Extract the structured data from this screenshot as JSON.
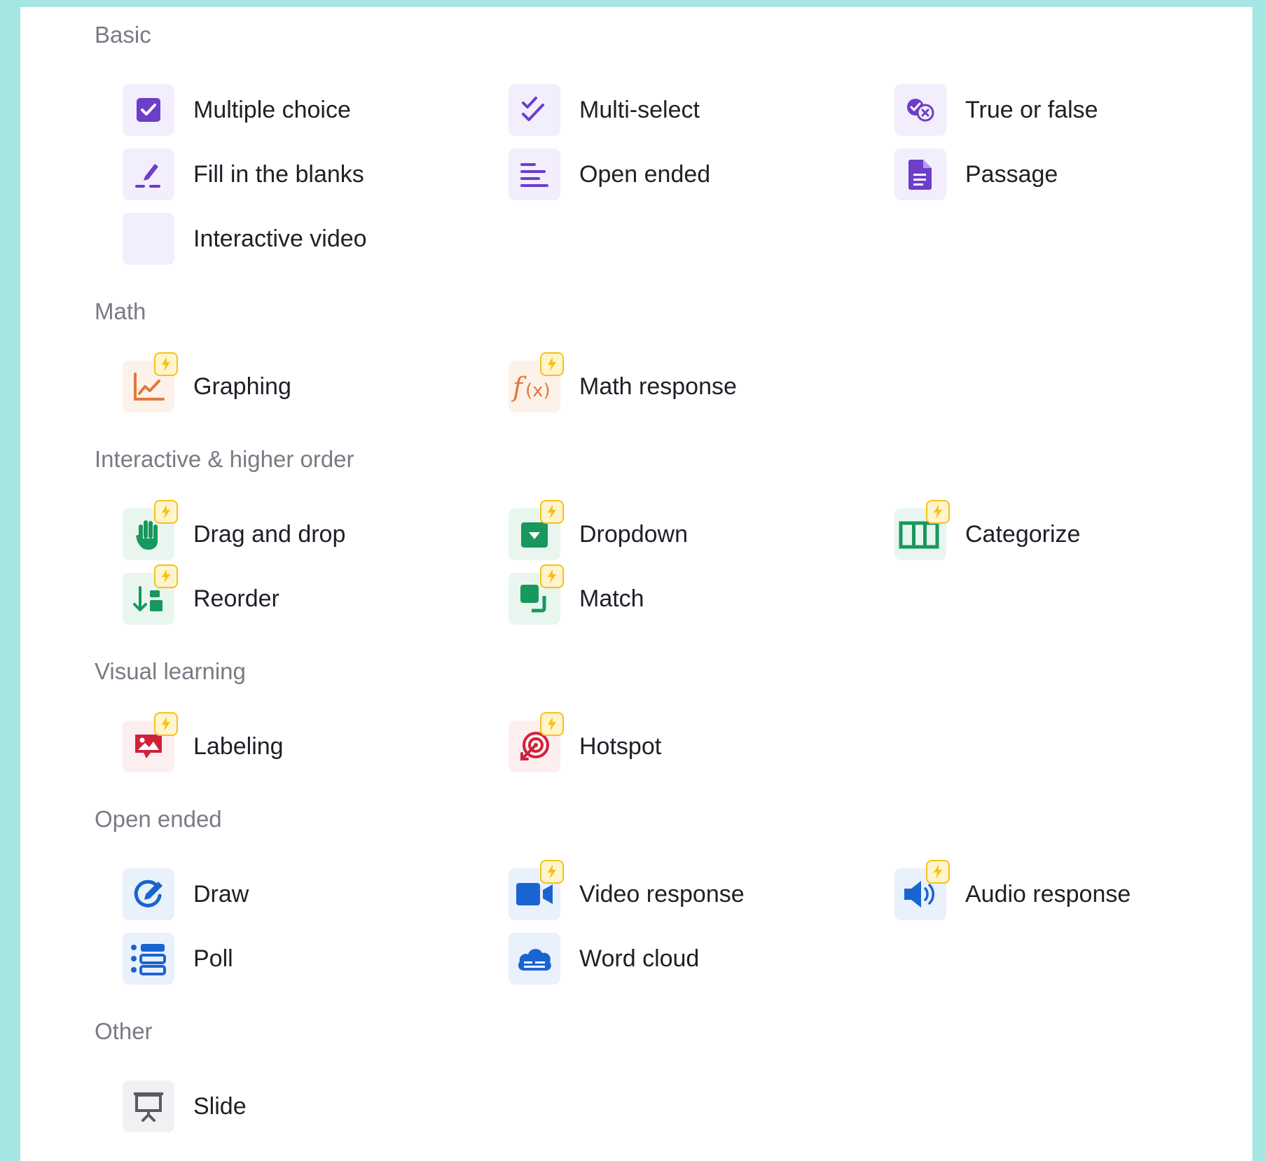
{
  "colors": {
    "page_background": "#a6e6e2",
    "panel_background": "#ffffff",
    "purple": "#6d3ec8",
    "orange": "#e2783a",
    "green": "#17985c",
    "red": "#d0213b",
    "blue": "#1a64d2",
    "gray": "#5a5a66",
    "bolt_badge": "#f4c21b"
  },
  "sections": {
    "basic": {
      "title": "Basic",
      "items": [
        {
          "label": "Multiple choice",
          "icon": "checkbox-icon"
        },
        {
          "label": "Multi-select",
          "icon": "double-check-icon"
        },
        {
          "label": "True or false",
          "icon": "check-x-icon"
        },
        {
          "label": "Fill in the blanks",
          "icon": "pen-blank-icon"
        },
        {
          "label": "Open ended",
          "icon": "text-lines-icon"
        },
        {
          "label": "Passage",
          "icon": "document-icon"
        },
        {
          "label": "Interactive video",
          "icon": "blank-tile-icon"
        }
      ]
    },
    "math": {
      "title": "Math",
      "items": [
        {
          "label": "Graphing",
          "icon": "chart-icon"
        },
        {
          "label": "Math response",
          "icon": "function-icon"
        }
      ]
    },
    "interactive": {
      "title": "Interactive & higher order",
      "items": [
        {
          "label": "Drag and drop",
          "icon": "hand-icon"
        },
        {
          "label": "Dropdown",
          "icon": "dropdown-icon"
        },
        {
          "label": "Categorize",
          "icon": "columns-icon"
        },
        {
          "label": "Reorder",
          "icon": "reorder-icon"
        },
        {
          "label": "Match",
          "icon": "match-icon"
        }
      ]
    },
    "visual": {
      "title": "Visual learning",
      "items": [
        {
          "label": "Labeling",
          "icon": "image-label-icon"
        },
        {
          "label": "Hotspot",
          "icon": "target-icon"
        }
      ]
    },
    "open_ended": {
      "title": "Open ended",
      "items": [
        {
          "label": "Draw",
          "icon": "draw-icon"
        },
        {
          "label": "Video response",
          "icon": "video-camera-icon"
        },
        {
          "label": "Audio response",
          "icon": "speaker-icon"
        },
        {
          "label": "Poll",
          "icon": "poll-icon"
        },
        {
          "label": "Word cloud",
          "icon": "cloud-icon"
        }
      ]
    },
    "other": {
      "title": "Other",
      "items": [
        {
          "label": "Slide",
          "icon": "presentation-icon"
        }
      ]
    }
  }
}
